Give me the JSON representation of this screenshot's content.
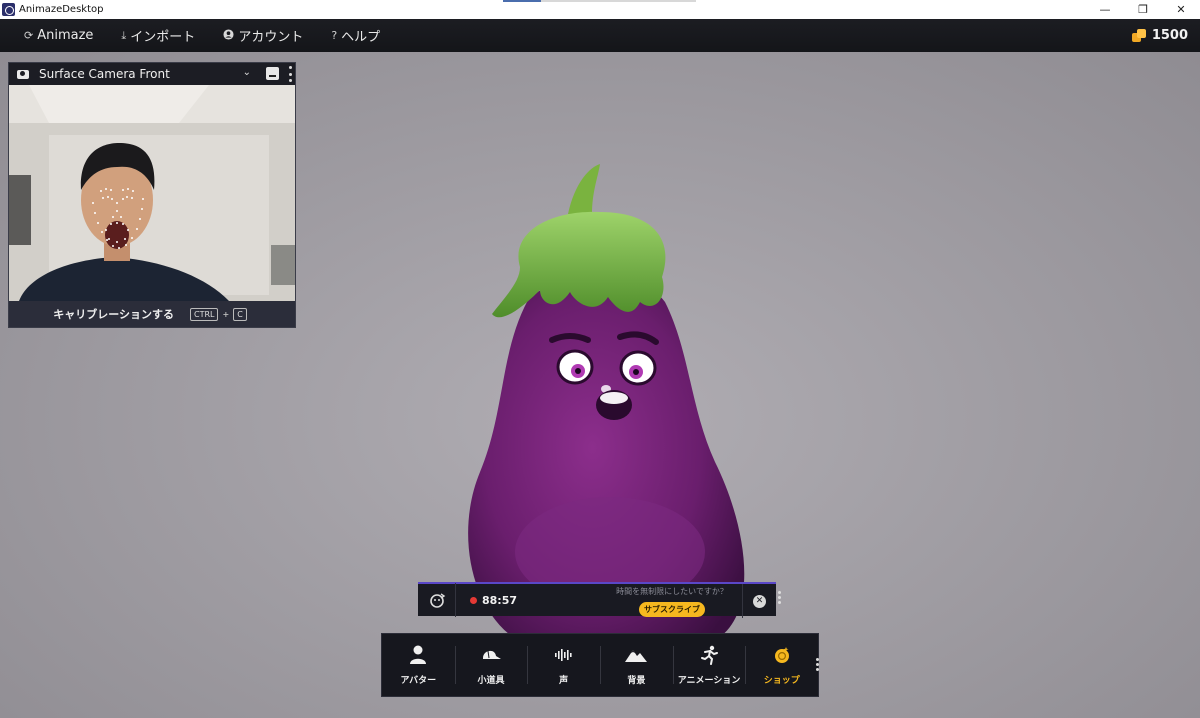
{
  "window": {
    "title": "AnimazeDesktop",
    "controls": {
      "minimize": "—",
      "restore": "❐",
      "close": "✕"
    }
  },
  "menu": {
    "items": [
      {
        "label": "Animaze",
        "icon": "animaze-logo-icon"
      },
      {
        "label": "インポート",
        "icon": "import-icon"
      },
      {
        "label": "アカウント",
        "icon": "account-icon"
      },
      {
        "label": "ヘルプ",
        "icon": "help-icon",
        "glyph": "?"
      }
    ],
    "coins": {
      "value": "1500",
      "icon": "coins-icon",
      "color": "#f0a825"
    }
  },
  "camera": {
    "title": "Surface Camera Front",
    "calibrate_label": "キャリブレーションする",
    "shortcut_key1": "CTRL",
    "shortcut_plus": "+",
    "shortcut_key2": "C"
  },
  "timer": {
    "time": "88:57",
    "promo_text": "時間を無制限にしたいですか？",
    "subscribe_label": "サブスクライブ",
    "close_glyph": "✕",
    "accent_color": "#5a47c8",
    "record_color": "#e53935"
  },
  "toolbar": {
    "items": [
      {
        "label": "アバター",
        "icon": "person-icon"
      },
      {
        "label": "小道具",
        "icon": "cap-icon"
      },
      {
        "label": "声",
        "icon": "voice-wave-icon"
      },
      {
        "label": "背景",
        "icon": "mountain-icon"
      },
      {
        "label": "アニメーション",
        "icon": "running-icon"
      },
      {
        "label": "ショップ",
        "icon": "shop-coin-icon",
        "active": true
      }
    ],
    "active_color": "#f6b81f"
  }
}
